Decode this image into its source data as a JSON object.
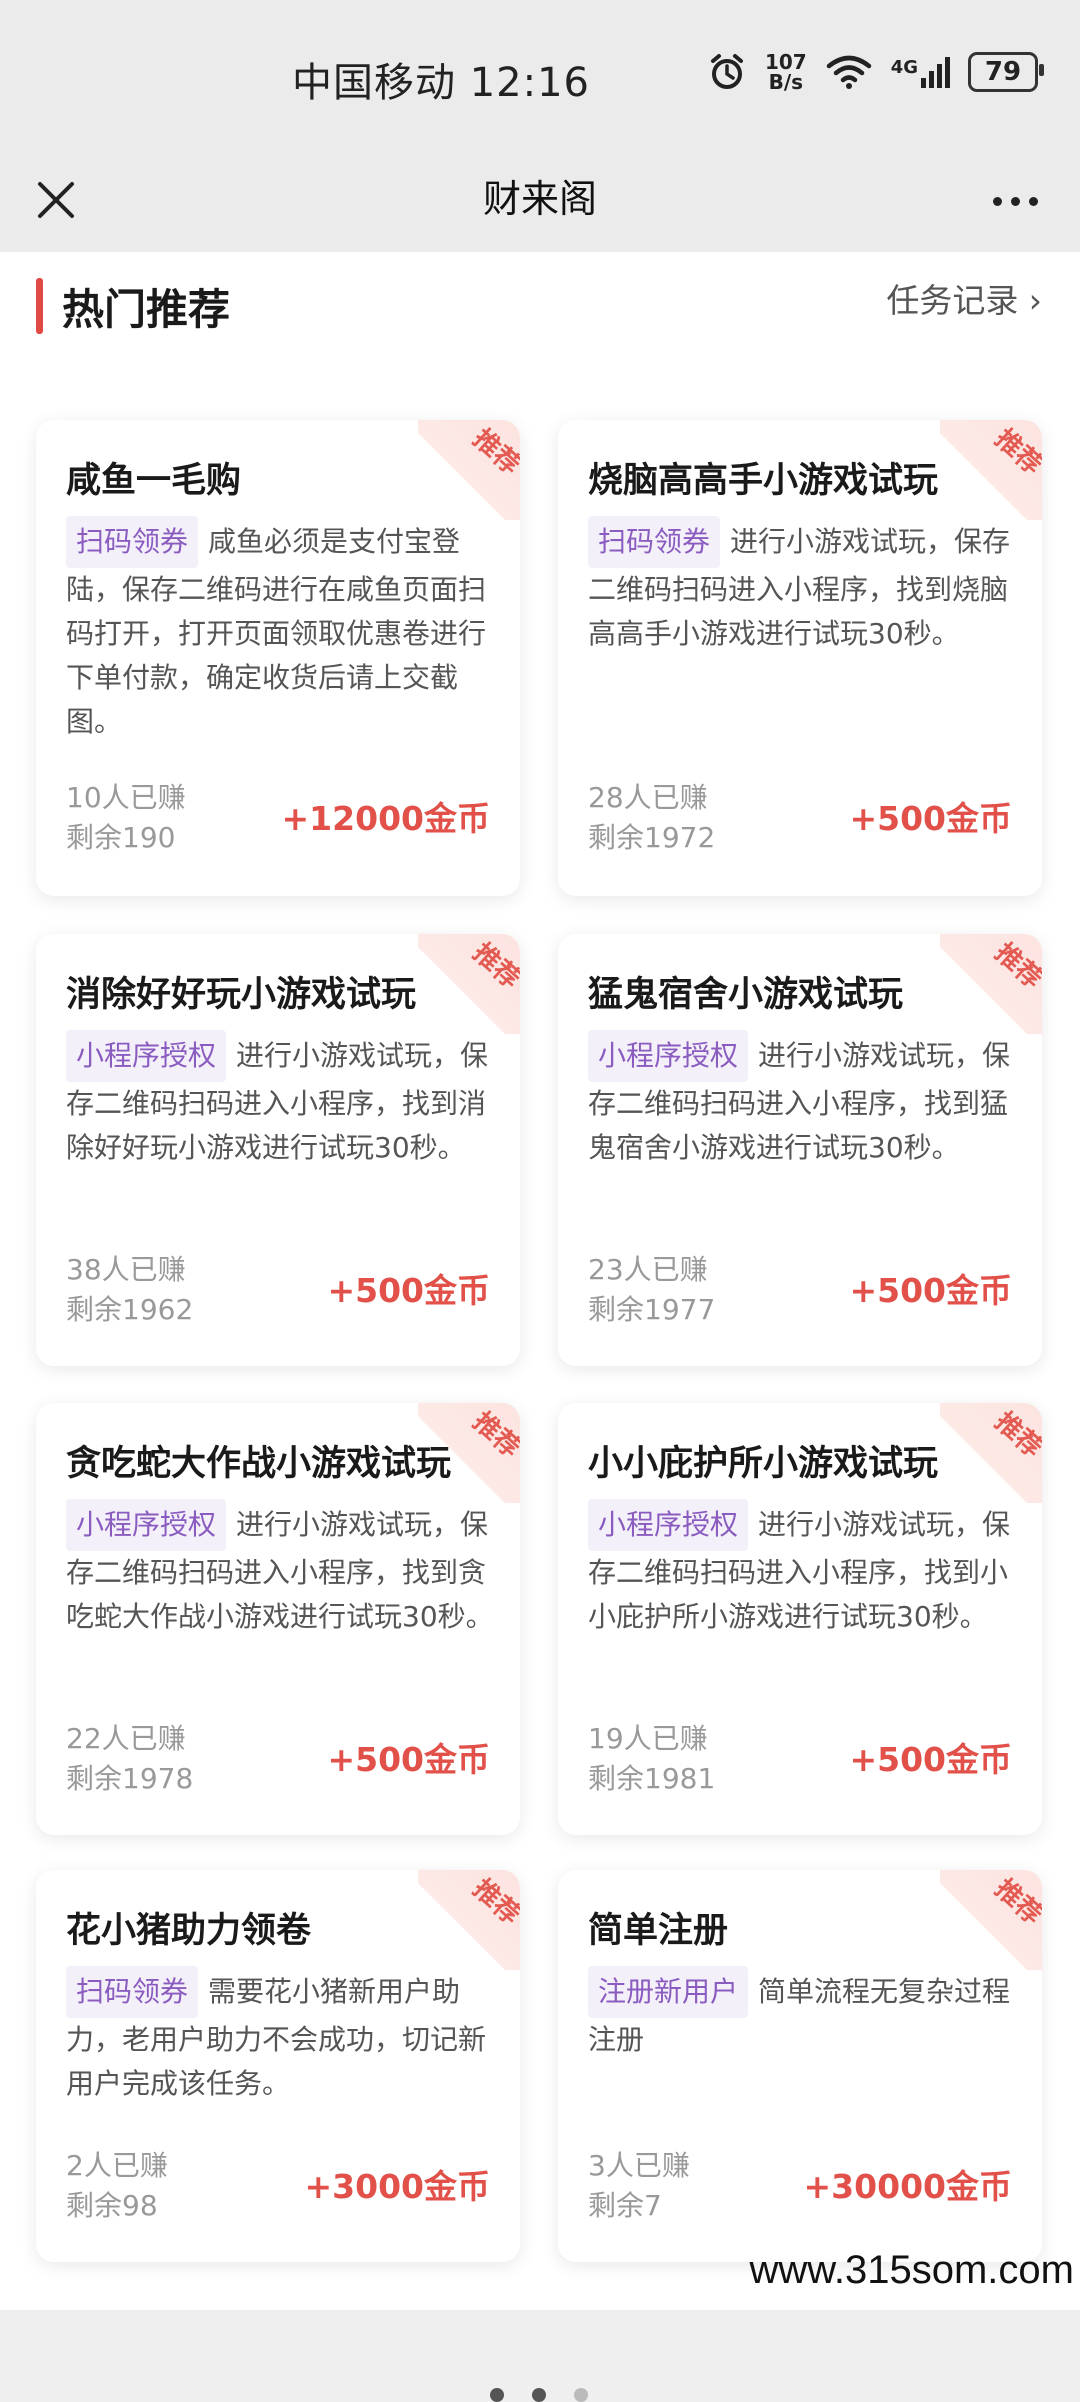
{
  "status_bar": {
    "carrier_time": "中国移动 12:16",
    "speed_value": "107",
    "speed_unit": "B/s",
    "network": "4G",
    "battery": "79",
    "icons": [
      "alarm-icon",
      "wifi-icon",
      "signal-icon",
      "battery-icon"
    ]
  },
  "nav": {
    "title": "财来阁",
    "close_icon": "close-icon",
    "more_icon": "more-icon"
  },
  "section": {
    "title": "热门推荐",
    "task_record": "任务记录 ›"
  },
  "badge_text": "推荐",
  "cards": [
    {
      "title": "咸鱼一毛购",
      "tag": "扫码领券",
      "desc": "咸鱼必须是支付宝登陆，保存二维码进行在咸鱼页面扫码打开，打开页面领取优惠卷进行下单付款，确定收货后请上交截图。",
      "earned": "10人已赚",
      "remaining": "剩余190",
      "reward": "+12000金币"
    },
    {
      "title": "烧脑高高手小游戏试玩",
      "tag": "扫码领券",
      "desc": "进行小游戏试玩，保存二维码扫码进入小程序，找到烧脑高高手小游戏进行试玩30秒。",
      "earned": "28人已赚",
      "remaining": "剩余1972",
      "reward": "+500金币"
    },
    {
      "title": "消除好好玩小游戏试玩",
      "tag": "小程序授权",
      "desc": "进行小游戏试玩，保存二维码扫码进入小程序，找到消除好好玩小游戏进行试玩30秒。",
      "earned": "38人已赚",
      "remaining": "剩余1962",
      "reward": "+500金币"
    },
    {
      "title": "猛鬼宿舍小游戏试玩",
      "tag": "小程序授权",
      "desc": "进行小游戏试玩，保存二维码扫码进入小程序，找到猛鬼宿舍小游戏进行试玩30秒。",
      "earned": "23人已赚",
      "remaining": "剩余1977",
      "reward": "+500金币"
    },
    {
      "title": "贪吃蛇大作战小游戏试玩",
      "tag": "小程序授权",
      "desc": "进行小游戏试玩，保存二维码扫码进入小程序，找到贪吃蛇大作战小游戏进行试玩30秒。",
      "earned": "22人已赚",
      "remaining": "剩余1978",
      "reward": "+500金币"
    },
    {
      "title": "小小庇护所小游戏试玩",
      "tag": "小程序授权",
      "desc": "进行小游戏试玩，保存二维码扫码进入小程序，找到小小庇护所小游戏进行试玩30秒。",
      "earned": "19人已赚",
      "remaining": "剩余1981",
      "reward": "+500金币"
    },
    {
      "title": "花小猪助力领卷",
      "tag": "扫码领券",
      "desc": "需要花小猪新用户助力，老用户助力不会成功，切记新用户完成该任务。",
      "earned": "2人已赚",
      "remaining": "剩余98",
      "reward": "+3000金币"
    },
    {
      "title": "简单注册",
      "tag": "注册新用户",
      "desc": "简单流程无复杂过程注册",
      "earned": "3人已赚",
      "remaining": "剩余7",
      "reward": "+30000金币"
    }
  ],
  "watermark": "www.315som.com"
}
